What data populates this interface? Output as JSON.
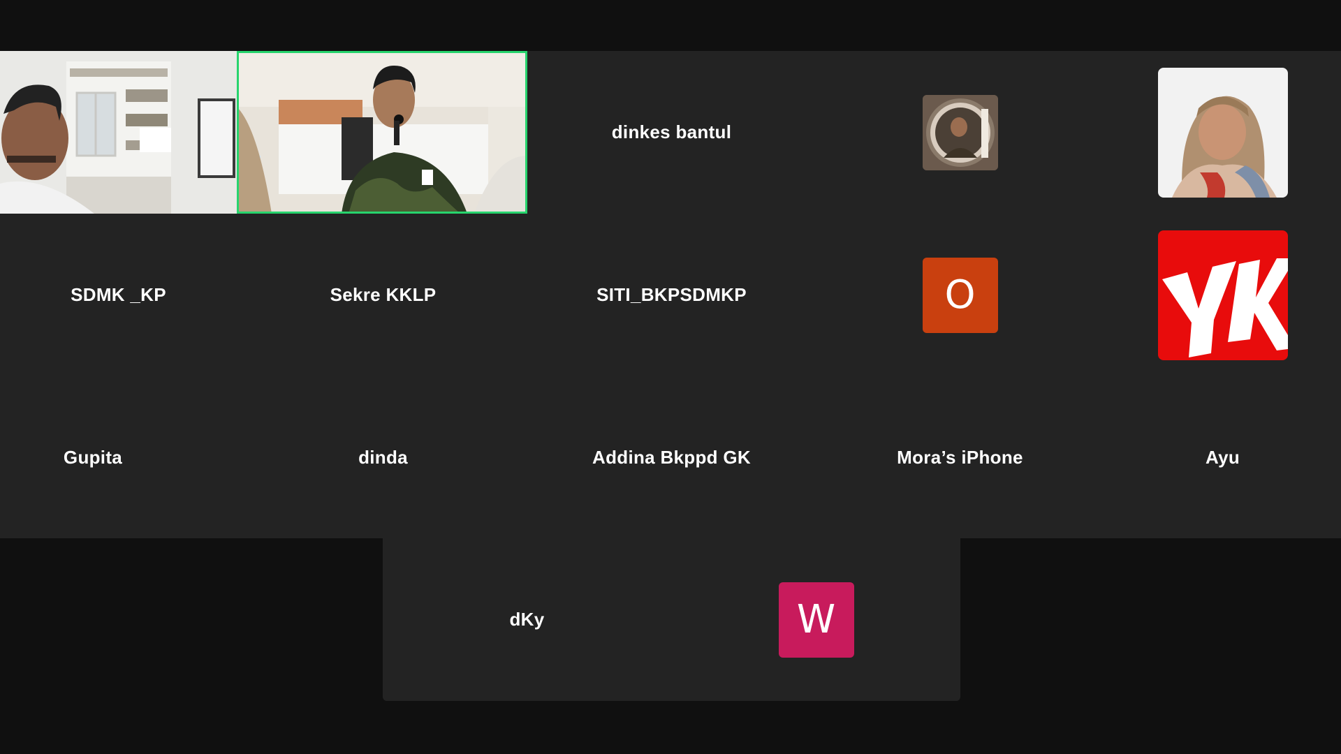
{
  "meeting": {
    "participants": [
      {
        "id": "p1",
        "name": "",
        "type": "video"
      },
      {
        "id": "p2",
        "name": "",
        "type": "video",
        "active_speaker": true
      },
      {
        "id": "p3",
        "name": "dinkes bantul",
        "type": "name"
      },
      {
        "id": "p4",
        "name": "",
        "type": "avatar-photo"
      },
      {
        "id": "p5",
        "name": "",
        "type": "avatar-photo"
      },
      {
        "id": "p6",
        "name": "SDMK _KP",
        "type": "name"
      },
      {
        "id": "p7",
        "name": "Sekre KKLP",
        "type": "name"
      },
      {
        "id": "p8",
        "name": "SITI_BKPSDMKP",
        "type": "name"
      },
      {
        "id": "p9",
        "name": "",
        "type": "initial",
        "initial": "O",
        "color": "#c9400f"
      },
      {
        "id": "p10",
        "name": "",
        "type": "logo",
        "logo_text": "YK",
        "color": "#e80c0c"
      },
      {
        "id": "p11",
        "name": "Gupita",
        "type": "name"
      },
      {
        "id": "p12",
        "name": "dinda",
        "type": "name"
      },
      {
        "id": "p13",
        "name": "Addina Bkppd GK",
        "type": "name"
      },
      {
        "id": "p14",
        "name": "Mora’s iPhone",
        "type": "name"
      },
      {
        "id": "p15",
        "name": "Ayu",
        "type": "name"
      },
      {
        "id": "p16",
        "name": "dKy",
        "type": "name"
      },
      {
        "id": "p17",
        "name": "",
        "type": "initial",
        "initial": "W",
        "color": "#c81b5c"
      }
    ]
  },
  "colors": {
    "background": "#101010",
    "tile_background": "#232323",
    "active_speaker_border": "#27d46d"
  }
}
